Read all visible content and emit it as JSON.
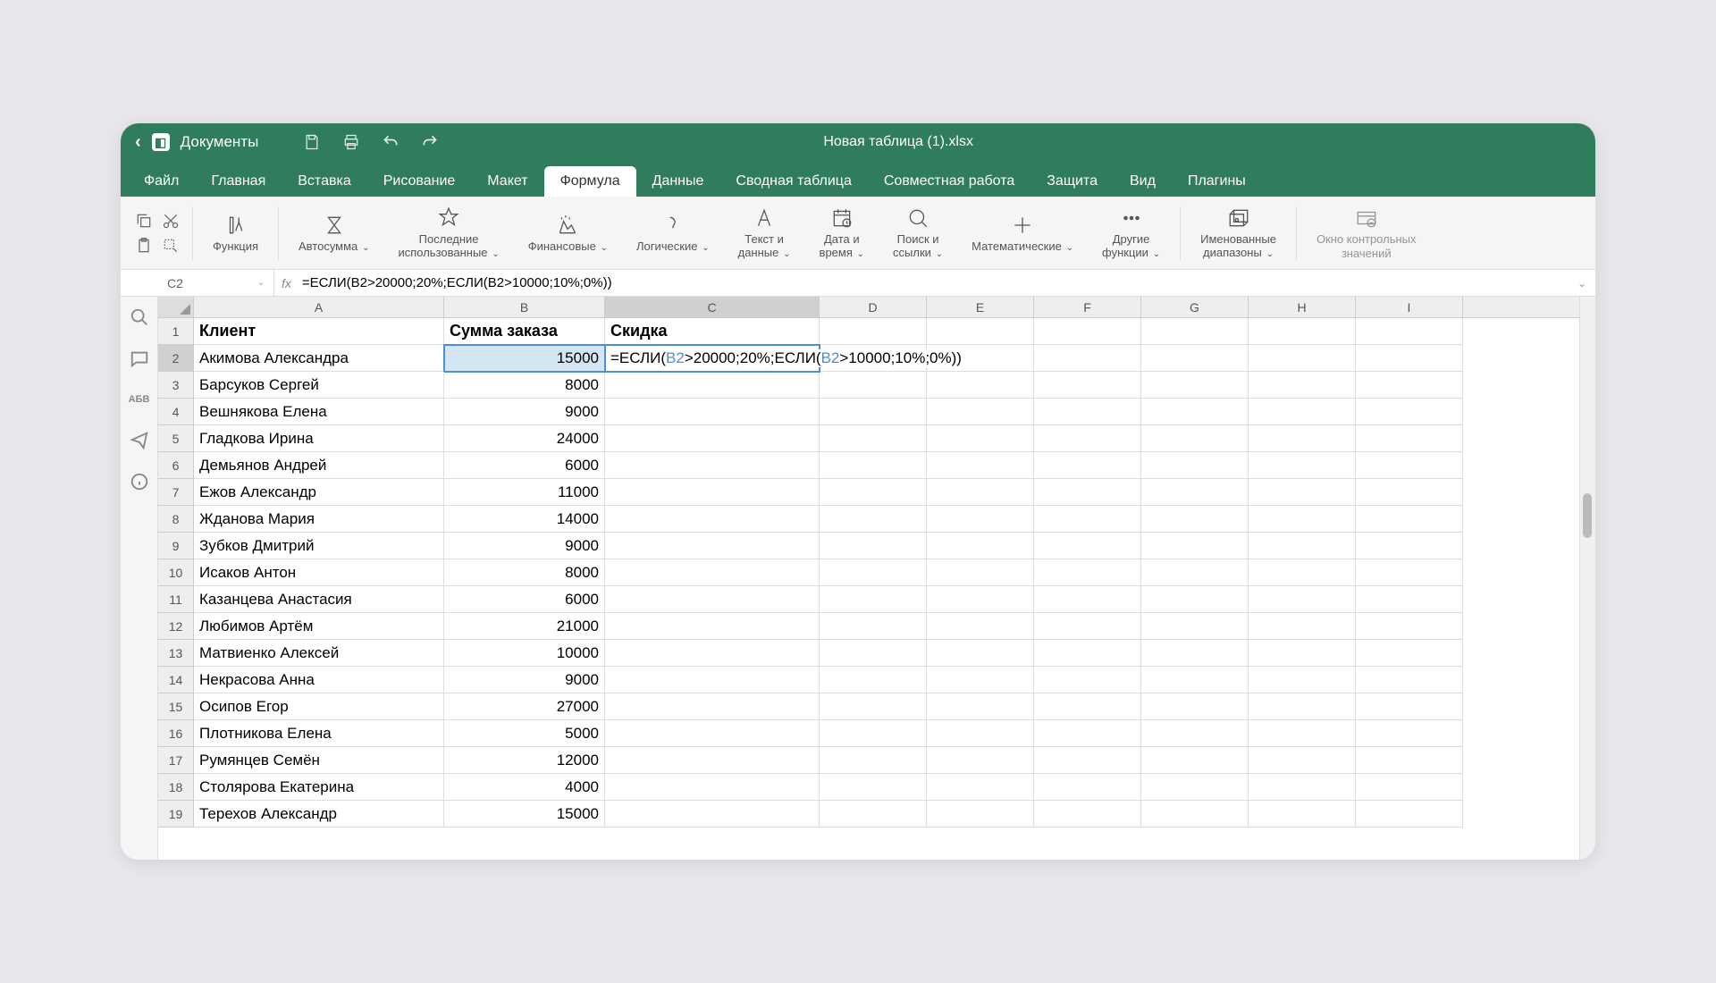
{
  "titlebar": {
    "app_name": "Документы",
    "doc_title": "Новая таблица (1).xlsx"
  },
  "menu": [
    "Файл",
    "Главная",
    "Вставка",
    "Рисование",
    "Макет",
    "Формула",
    "Данные",
    "Сводная таблица",
    "Совместная работа",
    "Защита",
    "Вид",
    "Плагины"
  ],
  "menu_active_index": 5,
  "ribbon": [
    {
      "label": "Функция",
      "dropdown": false
    },
    {
      "label": "Автосумма",
      "dropdown": true
    },
    {
      "label": "Последние\nиспользованные",
      "dropdown": true
    },
    {
      "label": "Финансовые",
      "dropdown": true
    },
    {
      "label": "Логические",
      "dropdown": true
    },
    {
      "label": "Текст и\nданные",
      "dropdown": true
    },
    {
      "label": "Дата и\nвремя",
      "dropdown": true
    },
    {
      "label": "Поиск и\nссылки",
      "dropdown": true
    },
    {
      "label": "Математические",
      "dropdown": true
    },
    {
      "label": "Другие\nфункции",
      "dropdown": true
    },
    {
      "label": "Именованные\nдиапазоны",
      "dropdown": true
    },
    {
      "label": "Окно контрольных\nзначений",
      "dropdown": false
    }
  ],
  "formula_bar": {
    "cell_ref": "C2",
    "fx": "fx",
    "formula": "=ЕСЛИ(B2>20000;20%;ЕСЛИ(B2>10000;10%;0%))"
  },
  "columns": [
    "A",
    "B",
    "C",
    "D",
    "E",
    "F",
    "G",
    "H",
    "I"
  ],
  "active_col_index": 2,
  "active_row_index": 1,
  "headers": [
    "Клиент",
    "Сумма заказа",
    "Скидка"
  ],
  "rows": [
    {
      "n": 1
    },
    {
      "n": 2,
      "a": "Акимова Александра",
      "b": "15000",
      "selected": true,
      "editing": true
    },
    {
      "n": 3,
      "a": "Барсуков Сергей",
      "b": "8000"
    },
    {
      "n": 4,
      "a": "Вешнякова Елена",
      "b": "9000"
    },
    {
      "n": 5,
      "a": "Гладкова Ирина",
      "b": "24000"
    },
    {
      "n": 6,
      "a": "Демьянов Андрей",
      "b": "6000"
    },
    {
      "n": 7,
      "a": "Ежов Александр",
      "b": "11000"
    },
    {
      "n": 8,
      "a": "Жданова Мария",
      "b": "14000"
    },
    {
      "n": 9,
      "a": "Зубков Дмитрий",
      "b": "9000"
    },
    {
      "n": 10,
      "a": "Исаков Антон",
      "b": "8000"
    },
    {
      "n": 11,
      "a": "Казанцева Анастасия",
      "b": "6000"
    },
    {
      "n": 12,
      "a": "Любимов Артём",
      "b": "21000"
    },
    {
      "n": 13,
      "a": "Матвиенко Алексей",
      "b": "10000"
    },
    {
      "n": 14,
      "a": "Некрасова Анна",
      "b": "9000"
    },
    {
      "n": 15,
      "a": "Осипов Егор",
      "b": "27000"
    },
    {
      "n": 16,
      "a": "Плотникова Елена",
      "b": "5000"
    },
    {
      "n": 17,
      "a": "Румянцев Семён",
      "b": "12000"
    },
    {
      "n": 18,
      "a": "Столярова Екатерина",
      "b": "4000"
    },
    {
      "n": 19,
      "a": "Терехов Александр",
      "b": "15000"
    }
  ],
  "editing_formula_parts": [
    "=ЕСЛИ(",
    "B2",
    ">20000;20%;ЕСЛИ(",
    "B2",
    ">10000;10%;0%))"
  ]
}
